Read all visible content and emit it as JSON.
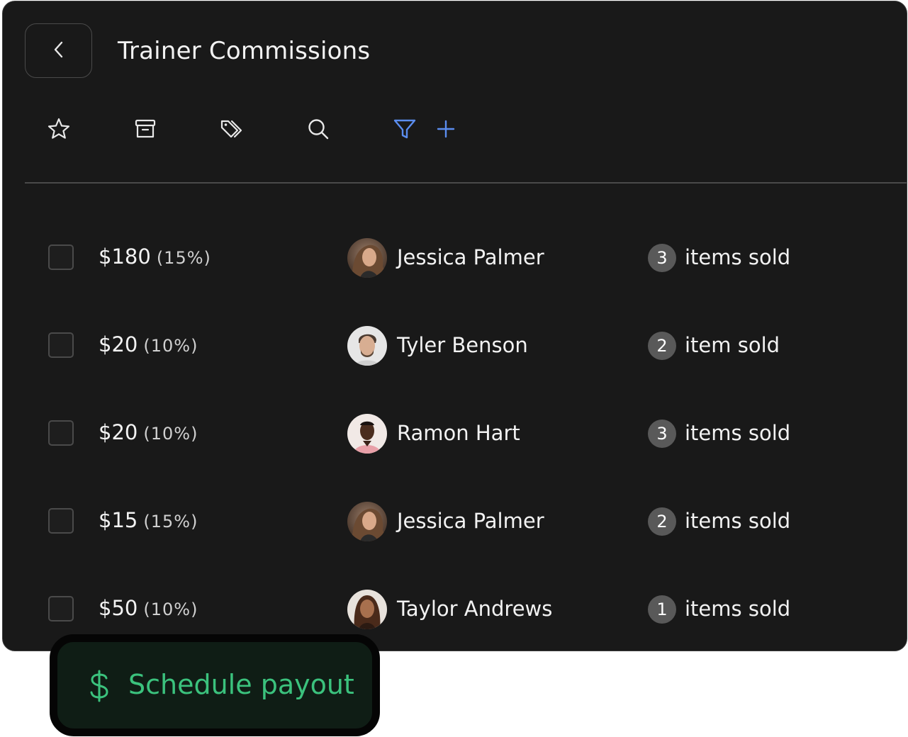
{
  "header": {
    "title": "Trainer Commissions",
    "back_icon": "chevron-left-icon"
  },
  "toolbar": {
    "icons": [
      "star-icon",
      "archive-icon",
      "tags-icon",
      "search-icon",
      "filter-icon",
      "plus-icon"
    ],
    "accent_color": "#5b8def"
  },
  "rows": [
    {
      "amount": "$180",
      "percent": "(15%)",
      "name": "Jessica Palmer",
      "count": "3",
      "label": "items sold"
    },
    {
      "amount": "$20",
      "percent": "(10%)",
      "name": "Tyler Benson",
      "count": "2",
      "label": "item sold"
    },
    {
      "amount": "$20",
      "percent": "(10%)",
      "name": "Ramon Hart",
      "count": "3",
      "label": "items sold"
    },
    {
      "amount": "$15",
      "percent": "(15%)",
      "name": "Jessica Palmer",
      "count": "2",
      "label": "items sold"
    },
    {
      "amount": "$50",
      "percent": "(10%)",
      "name": "Taylor Andrews",
      "count": "1",
      "label": "items sold"
    }
  ],
  "footer": {
    "payout_label": "Schedule payout",
    "payout_icon": "dollar-icon",
    "payout_color": "#3bc27d"
  }
}
